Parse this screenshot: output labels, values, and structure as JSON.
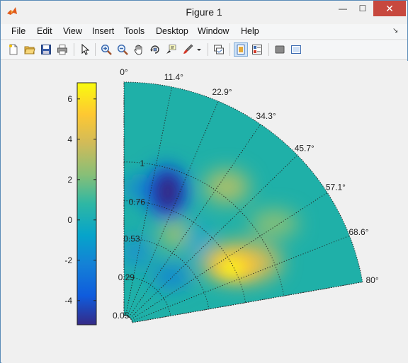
{
  "window": {
    "title": "Figure 1",
    "minimize_label": "—",
    "maximize_label": "☐",
    "close_label": "✕"
  },
  "menu": {
    "items": [
      "File",
      "Edit",
      "View",
      "Insert",
      "Tools",
      "Desktop",
      "Window",
      "Help"
    ],
    "overflow_arrow": "↘"
  },
  "toolbar": {
    "buttons": [
      "new-figure-icon",
      "open-file-icon",
      "save-icon",
      "print-icon",
      "edit-plot-arrow-icon",
      "zoom-in-icon",
      "zoom-out-icon",
      "pan-hand-icon",
      "rotate-3d-icon",
      "data-cursor-icon",
      "brush-icon",
      "link-plot-icon",
      "hide-plot-tools-icon",
      "show-plot-tools-icon",
      "dock-icon",
      "layout-icon"
    ]
  },
  "colorbar": {
    "ticks": [
      "6",
      "4",
      "2",
      "0",
      "-2",
      "-4"
    ],
    "range": [
      -5.2,
      6.8
    ],
    "colormap": "parula"
  },
  "polar": {
    "angle_labels": [
      "0°",
      "11.4°",
      "22.9°",
      "34.3°",
      "45.7°",
      "57.1°",
      "68.6°",
      "80°"
    ],
    "radial_labels": [
      "1",
      "0.76",
      "0.53",
      "0.29",
      "0.05"
    ]
  }
}
